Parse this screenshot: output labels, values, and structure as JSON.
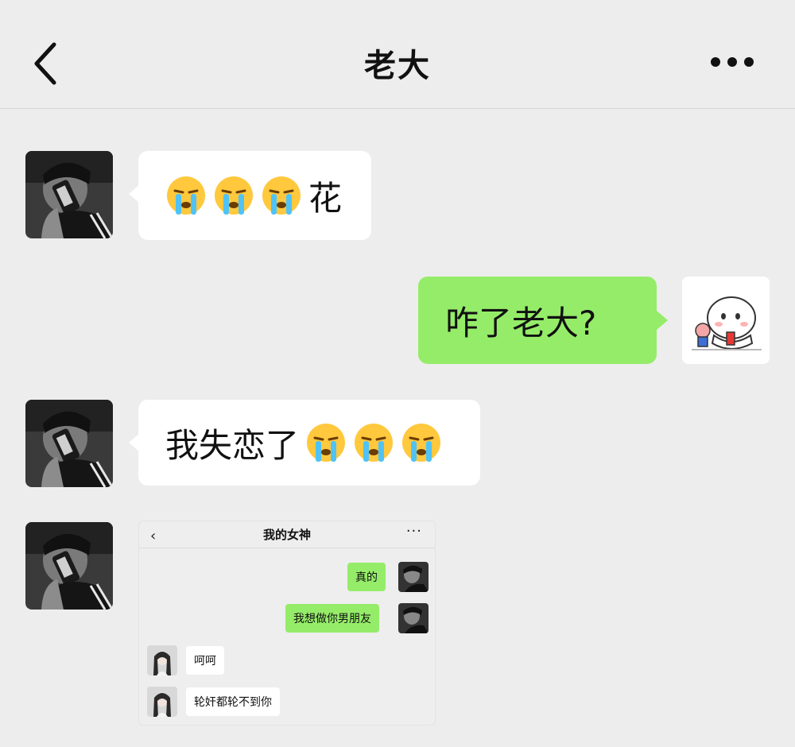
{
  "header": {
    "title": "老大",
    "back_icon": "chevron-left-icon",
    "more_icon": "ellipsis-icon"
  },
  "messages": [
    {
      "side": "left",
      "emoji_icon": "crying-face-icon",
      "emoji_count": 3,
      "text": "花"
    },
    {
      "side": "right",
      "text": "咋了老大?",
      "avatar_icon": "sticker-avatar-icon"
    },
    {
      "side": "left",
      "text": "我失恋了",
      "emoji_icon": "crying-face-icon",
      "emoji_count": 3
    },
    {
      "side": "left",
      "type": "image"
    }
  ],
  "embedded_chat": {
    "title": "我的女神",
    "back_glyph": "‹",
    "more_glyph": "···",
    "messages": [
      {
        "side": "right",
        "text": "真的"
      },
      {
        "side": "right",
        "text": "我想做你男朋友"
      },
      {
        "side": "left",
        "text": "呵呵"
      },
      {
        "side": "left",
        "text": "轮奸都轮不到你"
      }
    ]
  },
  "colors": {
    "background": "#ededed",
    "outgoing_bubble": "#95ec69",
    "incoming_bubble": "#ffffff"
  }
}
